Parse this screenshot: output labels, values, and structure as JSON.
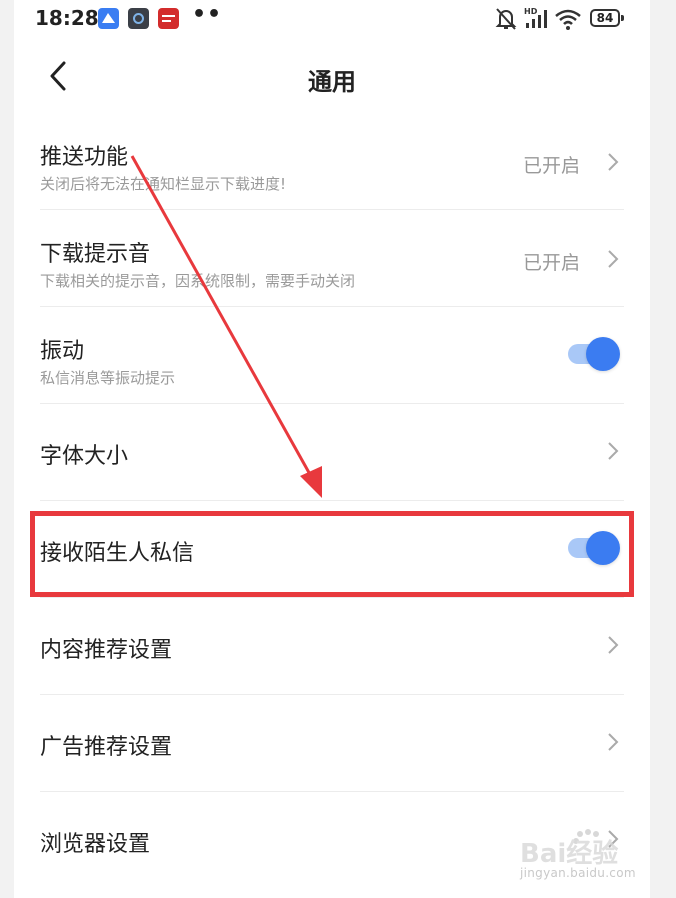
{
  "status_bar": {
    "time": "18:28",
    "battery": "84",
    "network_badge": "HD",
    "icons": [
      "notification-app-icon",
      "browser-app-icon",
      "news-app-icon",
      "more-dots-icon",
      "mute-bell-icon",
      "signal-icon",
      "wifi-icon",
      "battery-icon"
    ]
  },
  "header": {
    "title": "通用",
    "back_icon": "chevron-left-icon"
  },
  "settings": [
    {
      "title": "推送功能",
      "subtitle": "关闭后将无法在通知栏显示下载进度!",
      "value": "已开启",
      "control": "chevron"
    },
    {
      "title": "下载提示音",
      "subtitle": "下载相关的提示音，因系统限制，需要手动关闭",
      "value": "已开启",
      "control": "chevron"
    },
    {
      "title": "振动",
      "subtitle": "私信消息等振动提示",
      "control": "toggle",
      "on": true
    },
    {
      "title": "字体大小",
      "control": "chevron"
    },
    {
      "title": "接收陌生人私信",
      "control": "toggle",
      "on": true
    },
    {
      "title": "内容推荐设置",
      "control": "chevron"
    },
    {
      "title": "广告推荐设置",
      "control": "chevron"
    },
    {
      "title": "浏览器设置",
      "control": "chevron"
    }
  ],
  "annotation": {
    "color": "#e8393d",
    "highlighted_item": "接收陌生人私信"
  },
  "watermark": {
    "logo": "Bai经验",
    "url": "jingyan.baidu.com"
  },
  "colors": {
    "accent": "#3b7cf1",
    "toggle_track": "#a9c8f7",
    "annotation": "#e8393d",
    "secondary_text": "#9a9a9a"
  }
}
